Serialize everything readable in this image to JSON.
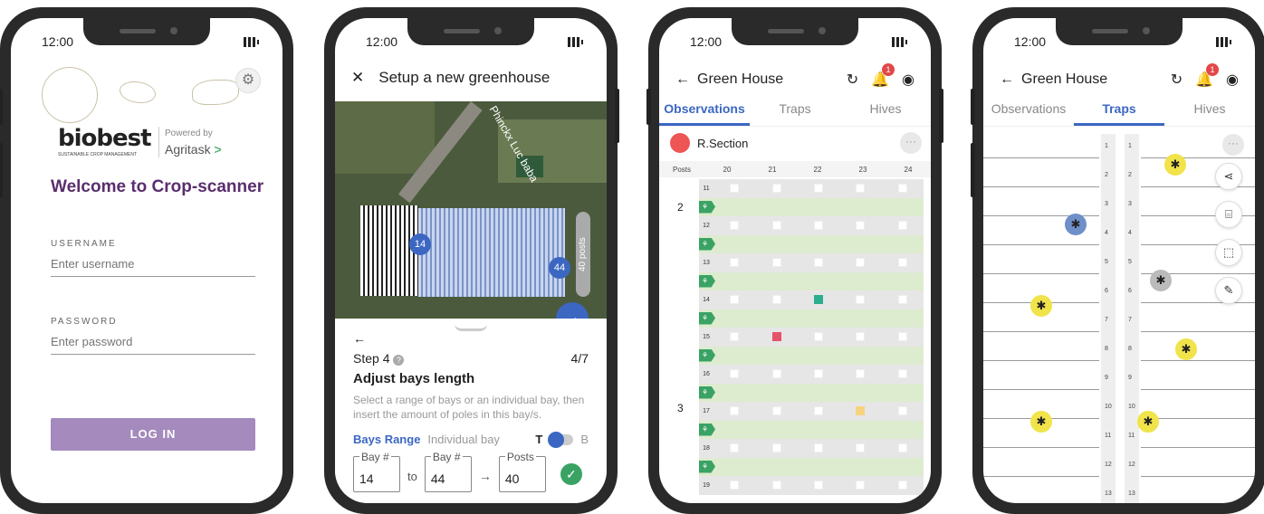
{
  "status": {
    "time": "12:00"
  },
  "login": {
    "brand": "biobest",
    "brand_tagline": "SUSTAINABLE CROP MANAGEMENT",
    "powered_by": "Powered by",
    "partner": "Agritask",
    "welcome": "Welcome to Crop-scanner",
    "username_label": "USERNAME",
    "username_placeholder": "Enter username",
    "password_label": "PASSWORD",
    "password_placeholder": "Enter password",
    "login_button": "LOG IN"
  },
  "setup": {
    "title": "Setup a new greenhouse",
    "road_name": "Phinckx Luc baba",
    "marker_start": "14",
    "marker_end": "44",
    "posts_overlay": "40 posts",
    "step_label": "Step 4",
    "step_progress": "4/7",
    "step_title": "Adjust bays length",
    "step_description": "Select a range of bays or an individual bay, then insert the amount of poles in this bay/s.",
    "mode_range": "Bays Range",
    "mode_individual": "Individual bay",
    "toggle_left": "T",
    "toggle_right": "B",
    "from_label": "Bay #",
    "from_value": "14",
    "to_word": "to",
    "to_label": "Bay #",
    "to_value": "44",
    "posts_label": "Posts",
    "posts_value": "40"
  },
  "observations": {
    "title": "Green House",
    "badge": "1",
    "tabs": [
      "Observations",
      "Traps",
      "Hives"
    ],
    "section": "R.Section",
    "posts_header": [
      "Posts",
      "20",
      "21",
      "22",
      "23",
      "24"
    ],
    "bay_labels": [
      "2",
      "3"
    ],
    "rows": [
      {
        "num": "11",
        "marks": [
          0,
          0,
          0,
          0,
          0
        ]
      },
      {
        "num": "12",
        "marks": [
          0,
          0,
          0,
          0,
          0
        ]
      },
      {
        "num": "13",
        "marks": [
          0,
          0,
          0,
          0,
          0
        ]
      },
      {
        "num": "14",
        "marks": [
          0,
          0,
          1,
          0,
          0
        ]
      },
      {
        "num": "15",
        "marks": [
          0,
          2,
          0,
          0,
          0
        ]
      },
      {
        "num": "16",
        "marks": [
          0,
          0,
          0,
          0,
          0
        ]
      },
      {
        "num": "17",
        "marks": [
          0,
          0,
          0,
          3,
          0
        ]
      },
      {
        "num": "18",
        "marks": [
          0,
          0,
          0,
          0,
          0
        ]
      },
      {
        "num": "19",
        "marks": [
          0,
          0,
          0,
          0,
          0
        ]
      }
    ],
    "mark_colors": {
      "1": "#2bae8e",
      "2": "#e5536a",
      "3": "#f6d37e"
    }
  },
  "traps": {
    "title": "Green House",
    "badge": "1",
    "tabs": [
      "Observations",
      "Traps",
      "Hives"
    ],
    "post_numbers": [
      "1",
      "2",
      "3",
      "4",
      "5",
      "6",
      "7",
      "8",
      "9",
      "10",
      "11",
      "12",
      "13"
    ]
  }
}
